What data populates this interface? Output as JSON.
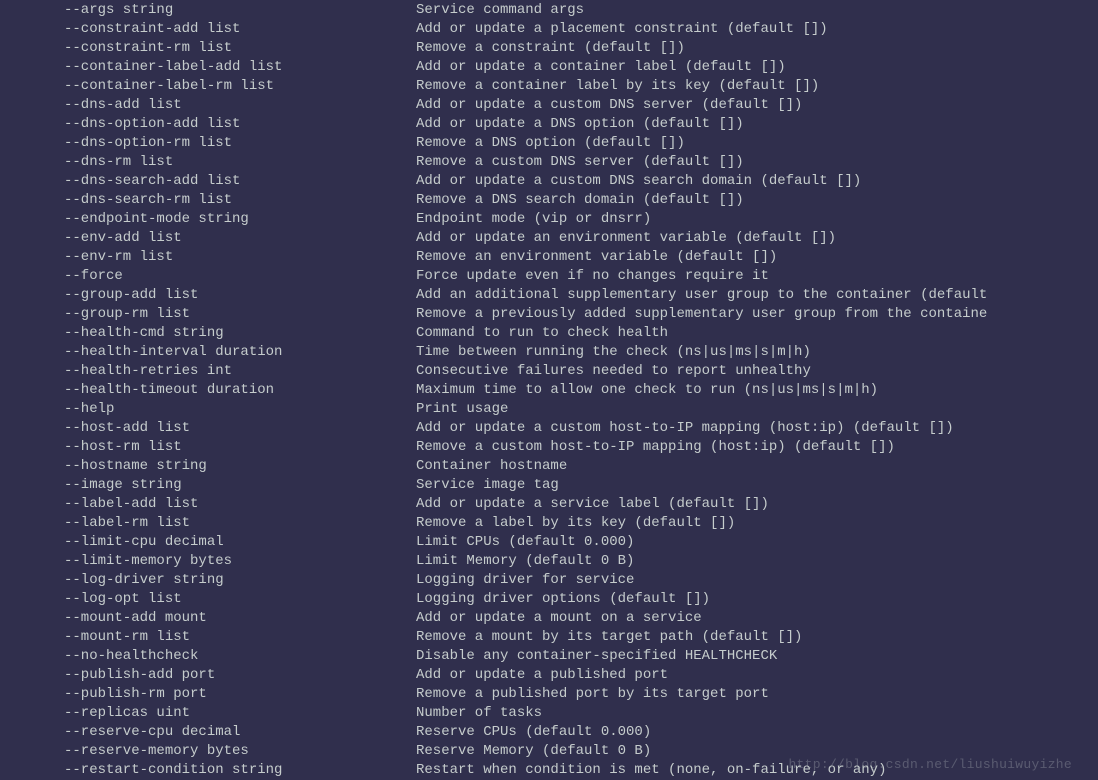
{
  "watermark": "http://blog.csdn.net/liushuiwuyizhe",
  "options": [
    {
      "flag": "--args string",
      "desc": "Service command args"
    },
    {
      "flag": "--constraint-add list",
      "desc": "Add or update a placement constraint (default [])"
    },
    {
      "flag": "--constraint-rm list",
      "desc": "Remove a constraint (default [])"
    },
    {
      "flag": "--container-label-add list",
      "desc": "Add or update a container label (default [])"
    },
    {
      "flag": "--container-label-rm list",
      "desc": "Remove a container label by its key (default [])"
    },
    {
      "flag": "--dns-add list",
      "desc": "Add or update a custom DNS server (default [])"
    },
    {
      "flag": "--dns-option-add list",
      "desc": "Add or update a DNS option (default [])"
    },
    {
      "flag": "--dns-option-rm list",
      "desc": "Remove a DNS option (default [])"
    },
    {
      "flag": "--dns-rm list",
      "desc": "Remove a custom DNS server (default [])"
    },
    {
      "flag": "--dns-search-add list",
      "desc": "Add or update a custom DNS search domain (default [])"
    },
    {
      "flag": "--dns-search-rm list",
      "desc": "Remove a DNS search domain (default [])"
    },
    {
      "flag": "--endpoint-mode string",
      "desc": "Endpoint mode (vip or dnsrr)"
    },
    {
      "flag": "--env-add list",
      "desc": "Add or update an environment variable (default [])"
    },
    {
      "flag": "--env-rm list",
      "desc": "Remove an environment variable (default [])"
    },
    {
      "flag": "--force",
      "desc": "Force update even if no changes require it"
    },
    {
      "flag": "--group-add list",
      "desc": "Add an additional supplementary user group to the container (default"
    },
    {
      "flag": "--group-rm list",
      "desc": "Remove a previously added supplementary user group from the containe"
    },
    {
      "flag": "--health-cmd string",
      "desc": "Command to run to check health"
    },
    {
      "flag": "--health-interval duration",
      "desc": "Time between running the check (ns|us|ms|s|m|h)"
    },
    {
      "flag": "--health-retries int",
      "desc": "Consecutive failures needed to report unhealthy"
    },
    {
      "flag": "--health-timeout duration",
      "desc": "Maximum time to allow one check to run (ns|us|ms|s|m|h)"
    },
    {
      "flag": "--help",
      "desc": "Print usage"
    },
    {
      "flag": "--host-add list",
      "desc": "Add or update a custom host-to-IP mapping (host:ip) (default [])"
    },
    {
      "flag": "--host-rm list",
      "desc": "Remove a custom host-to-IP mapping (host:ip) (default [])"
    },
    {
      "flag": "--hostname string",
      "desc": "Container hostname"
    },
    {
      "flag": "--image string",
      "desc": "Service image tag"
    },
    {
      "flag": "--label-add list",
      "desc": "Add or update a service label (default [])"
    },
    {
      "flag": "--label-rm list",
      "desc": "Remove a label by its key (default [])"
    },
    {
      "flag": "--limit-cpu decimal",
      "desc": "Limit CPUs (default 0.000)"
    },
    {
      "flag": "--limit-memory bytes",
      "desc": "Limit Memory (default 0 B)"
    },
    {
      "flag": "--log-driver string",
      "desc": "Logging driver for service"
    },
    {
      "flag": "--log-opt list",
      "desc": "Logging driver options (default [])"
    },
    {
      "flag": "--mount-add mount",
      "desc": "Add or update a mount on a service"
    },
    {
      "flag": "--mount-rm list",
      "desc": "Remove a mount by its target path (default [])"
    },
    {
      "flag": "--no-healthcheck",
      "desc": "Disable any container-specified HEALTHCHECK"
    },
    {
      "flag": "--publish-add port",
      "desc": "Add or update a published port"
    },
    {
      "flag": "--publish-rm port",
      "desc": "Remove a published port by its target port"
    },
    {
      "flag": "--replicas uint",
      "desc": "Number of tasks"
    },
    {
      "flag": "--reserve-cpu decimal",
      "desc": "Reserve CPUs (default 0.000)"
    },
    {
      "flag": "--reserve-memory bytes",
      "desc": "Reserve Memory (default 0 B)"
    },
    {
      "flag": "--restart-condition string",
      "desc": "Restart when condition is met (none, on-failure, or any)"
    }
  ]
}
